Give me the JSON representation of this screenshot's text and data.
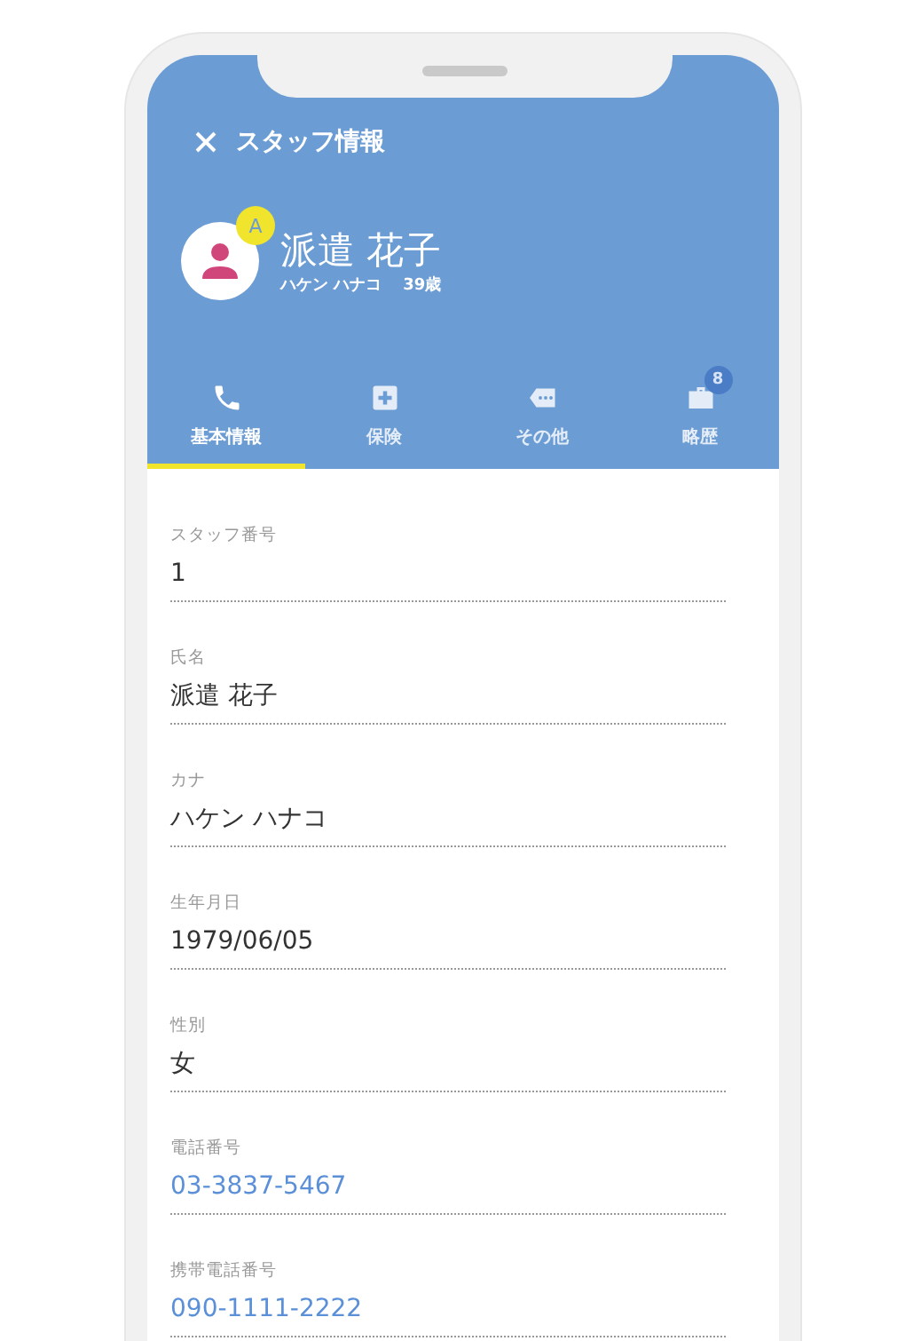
{
  "header": {
    "title": "スタッフ情報",
    "rank_badge": "A",
    "name": "派遣 花子",
    "kana": "ハケン ハナコ",
    "age": "39歳"
  },
  "tabs": [
    {
      "label": "基本情報",
      "selected": true
    },
    {
      "label": "保険",
      "selected": false
    },
    {
      "label": "その他",
      "selected": false
    },
    {
      "label": "略歴",
      "selected": false,
      "badge": "8"
    }
  ],
  "fields": [
    {
      "label": "スタッフ番号",
      "value": "1",
      "kind": "text"
    },
    {
      "label": "氏名",
      "value": "派遣 花子",
      "kind": "text"
    },
    {
      "label": "カナ",
      "value": "ハケン ハナコ",
      "kind": "text"
    },
    {
      "label": "生年月日",
      "value": "1979/06/05",
      "kind": "text"
    },
    {
      "label": "性別",
      "value": "女",
      "kind": "text"
    },
    {
      "label": "電話番号",
      "value": "03-3837-5467",
      "kind": "phone"
    },
    {
      "label": "携帯電話番号",
      "value": "090-1111-2222",
      "kind": "phone"
    }
  ]
}
